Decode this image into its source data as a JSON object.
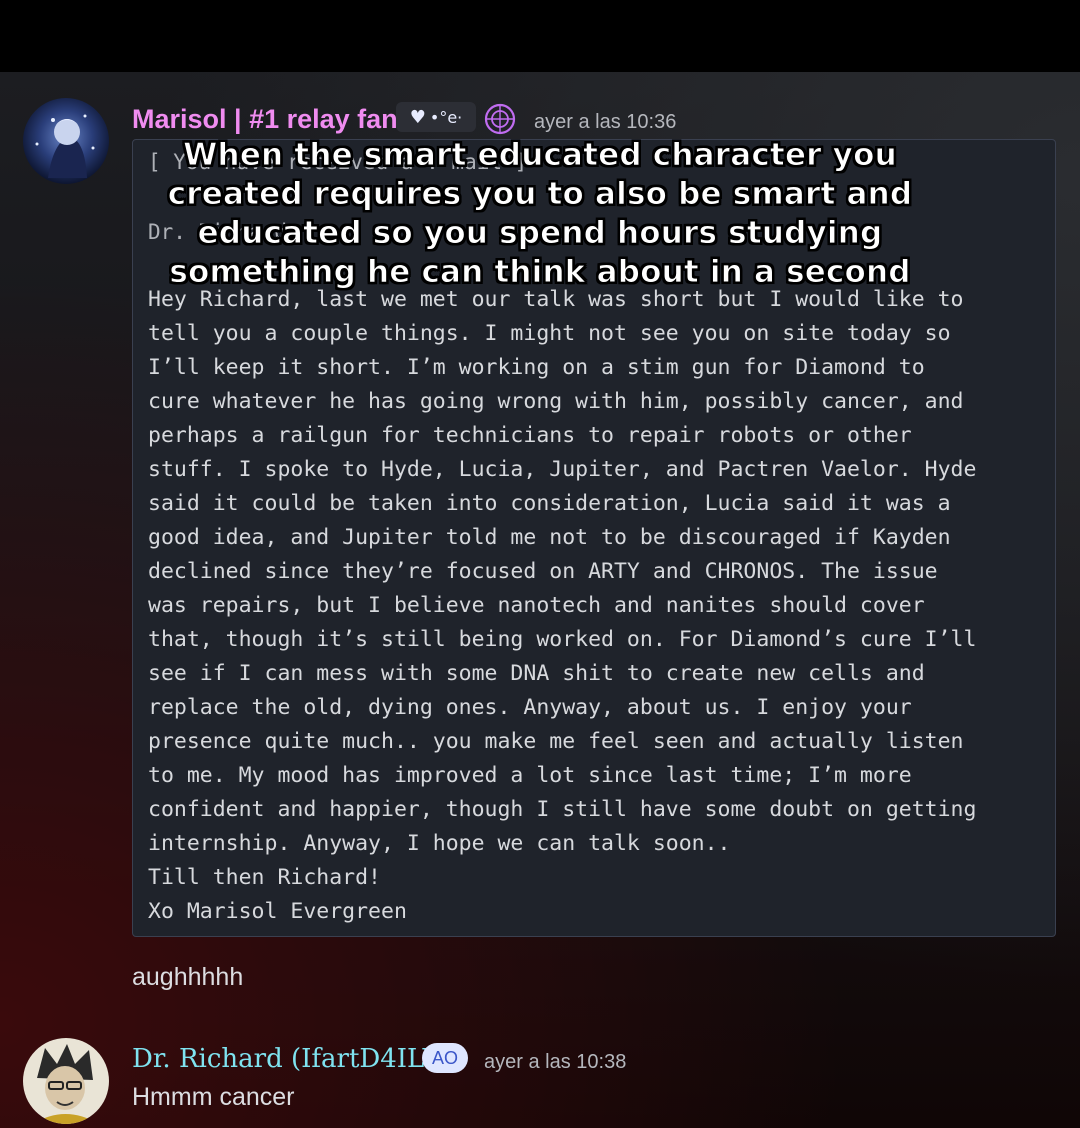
{
  "caption": {
    "lines": [
      "When the smart educated character you",
      "created requires you to also be smart and",
      "educated so you spend hours studying",
      "something he can think about in a second"
    ]
  },
  "messages": [
    {
      "author": "Marisol | #1 relay fan",
      "author_color": "#f08cf0",
      "server_tag": "•°e·",
      "timestamp": "ayer a las 10:36",
      "header_line_1": "[ You have received a . mail ]",
      "header_line_2": "Dr. Richard",
      "letter": [
        "Hey Richard, last we met our talk was short but I would like to",
        "tell you a couple things. I might not see you on site today so",
        "I’ll keep it short. I’m working on a stim gun for Diamond to",
        "cure whatever he has going wrong with him, possibly cancer, and",
        "perhaps a railgun for technicians to repair robots or other",
        "stuff. I spoke to Hyde, Lucia, Jupiter, and Pactren Vaelor. Hyde",
        "said it could be taken into consideration, Lucia said it was a",
        "good idea, and Jupiter told me not to be discouraged if Kayden",
        "declined since they’re focused on ARTY and CHRONOS. The issue",
        "was repairs, but I believe nanotech and nanites should cover",
        "that, though it’s still being worked on. For Diamond’s cure I’ll",
        "see if I can mess with some DNA shit to create new cells and",
        "replace the old, dying ones. Anyway, about us. I enjoy your",
        "presence quite much.. you make me feel seen and actually listen",
        "to me. My mood has improved a lot since last time; I’m more",
        "confident and happier, though I still have some doubt on getting",
        "internship. Anyway, I hope we can talk soon..",
        "Till then Richard!",
        "Xo Marisol Evergreen"
      ],
      "followup": "aughhhhh"
    },
    {
      "author": "Dr. Richard (IfartD4ILY)",
      "author_color": "#7fe3f0",
      "tag": "AO",
      "timestamp": "ayer a las 10:38",
      "text": "Hmmm cancer"
    }
  ],
  "colors": {
    "accent_purple": "#c06cf0",
    "box_bg": "#1f232b",
    "text": "#d7d9dd"
  }
}
